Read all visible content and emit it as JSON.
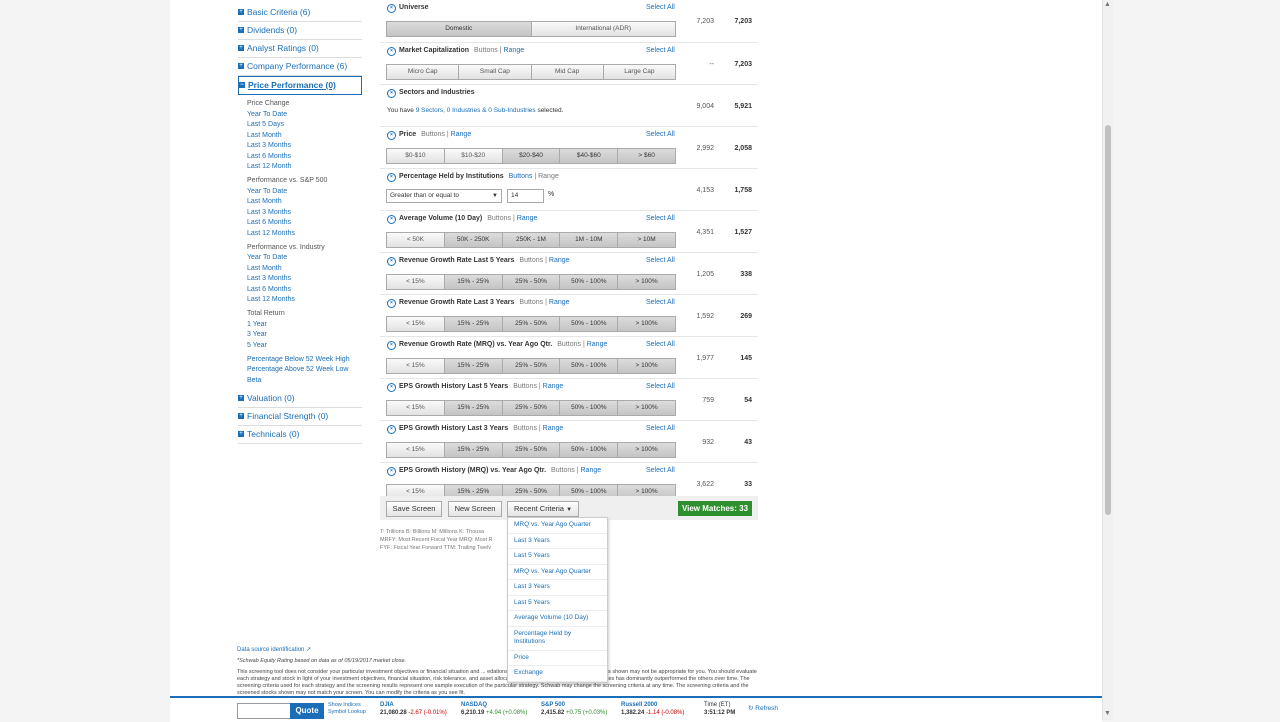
{
  "sidebar": {
    "categories_top": [
      {
        "label": "Basic Criteria (6)"
      },
      {
        "label": "Dividends (0)"
      },
      {
        "label": "Analyst Ratings (0)"
      },
      {
        "label": "Company Performance (6)"
      }
    ],
    "active_category": "Price Performance (0)",
    "subgroups": [
      {
        "heading": "Price Change",
        "links": [
          "Year To Date",
          "Last 5 Days",
          "Last Month",
          "Last 3 Months",
          "Last 6 Months",
          "Last 12 Month"
        ]
      },
      {
        "heading": "Performance vs. S&P 500",
        "links": [
          "Year To Date",
          "Last Month",
          "Last 3 Months",
          "Last 6 Months",
          "Last 12 Months"
        ]
      },
      {
        "heading": "Performance vs. Industry",
        "links": [
          "Year To Date",
          "Last Month",
          "Last 3 Months",
          "Last 6 Months",
          "Last 12 Months"
        ]
      },
      {
        "heading": "Total Return",
        "links": [
          "1 Year",
          "3 Year",
          "5 Year"
        ]
      },
      {
        "heading": "",
        "links": [
          "Percentage Below 52 Week High",
          "Percentage Above 52 Week Low",
          "Beta"
        ]
      }
    ],
    "categories_bottom": [
      {
        "label": "Valuation (0)"
      },
      {
        "label": "Financial Strength (0)"
      },
      {
        "label": "Technicals (0)"
      }
    ]
  },
  "criteria": [
    {
      "title": "Universe",
      "modes": "",
      "select_all": "Select All",
      "count1": "7,203",
      "count2": "7,203",
      "kind": "buttons",
      "buttons": [
        {
          "label": "Domestic",
          "on": true
        },
        {
          "label": "International (ADR)",
          "on": false
        }
      ]
    },
    {
      "title": "Market Capitalization",
      "modes": "Buttons | Range",
      "select_all": "Select All",
      "count1": "--",
      "count2": "7,203",
      "kind": "buttons",
      "buttons": [
        {
          "label": "Micro Cap",
          "on": false
        },
        {
          "label": "Small Cap",
          "on": false
        },
        {
          "label": "Mid Cap",
          "on": false
        },
        {
          "label": "Large Cap",
          "on": false
        }
      ]
    },
    {
      "title": "Sectors and Industries",
      "modes": "",
      "select_all": "",
      "count1": "9,004",
      "count2": "5,921",
      "kind": "text",
      "text_pre": "You have ",
      "text_link": "9 Sectors, 0 Industries & 0 Sub-Industries",
      "text_post": " selected."
    },
    {
      "title": "Price",
      "modes": "Buttons | Range",
      "select_all": "Select All",
      "count1": "2,992",
      "count2": "2,058",
      "kind": "buttons",
      "buttons": [
        {
          "label": "$0-$10",
          "on": false
        },
        {
          "label": "$10-$20",
          "on": false
        },
        {
          "label": "$20-$40",
          "on": true
        },
        {
          "label": "$40-$60",
          "on": true
        },
        {
          "label": "> $60",
          "on": true
        }
      ]
    },
    {
      "title": "Percentage Held by Institutions",
      "modes": "Buttons | Range",
      "select_all": "",
      "count1": "4,153",
      "count2": "1,758",
      "kind": "select",
      "select_value": "Greater than or equal to",
      "input_value": "14",
      "unit": "%"
    },
    {
      "title": "Average Volume (10 Day)",
      "modes": "Buttons | Range",
      "select_all": "Select All",
      "count1": "4,351",
      "count2": "1,527",
      "kind": "buttons",
      "buttons": [
        {
          "label": "< 50K",
          "on": false
        },
        {
          "label": "50K - 250K",
          "on": true
        },
        {
          "label": "250K - 1M",
          "on": true
        },
        {
          "label": "1M - 10M",
          "on": true
        },
        {
          "label": "> 10M",
          "on": true
        }
      ]
    },
    {
      "title": "Revenue Growth Rate Last 5 Years",
      "modes": "Buttons | Range",
      "select_all": "Select All",
      "count1": "1,205",
      "count2": "338",
      "kind": "buttons",
      "buttons": [
        {
          "label": "< 15%",
          "on": false
        },
        {
          "label": "15% - 25%",
          "on": true
        },
        {
          "label": "25% - 50%",
          "on": true
        },
        {
          "label": "50% - 100%",
          "on": true
        },
        {
          "label": "> 100%",
          "on": true
        }
      ]
    },
    {
      "title": "Revenue Growth Rate Last 3 Years",
      "modes": "Buttons | Range",
      "select_all": "Select All",
      "count1": "1,592",
      "count2": "269",
      "kind": "buttons",
      "buttons": [
        {
          "label": "< 15%",
          "on": false
        },
        {
          "label": "15% - 25%",
          "on": true
        },
        {
          "label": "25% - 50%",
          "on": true
        },
        {
          "label": "50% - 100%",
          "on": true
        },
        {
          "label": "> 100%",
          "on": true
        }
      ]
    },
    {
      "title": "Revenue Growth Rate (MRQ) vs. Year Ago Qtr.",
      "modes": "Buttons | Range",
      "select_all": "Select All",
      "count1": "1,977",
      "count2": "145",
      "kind": "buttons",
      "buttons": [
        {
          "label": "< 15%",
          "on": false
        },
        {
          "label": "15% - 25%",
          "on": true
        },
        {
          "label": "25% - 50%",
          "on": true
        },
        {
          "label": "50% - 100%",
          "on": true
        },
        {
          "label": "> 100%",
          "on": true
        }
      ]
    },
    {
      "title": "EPS Growth History Last 5 Years",
      "modes": "Buttons | Range",
      "select_all": "Select All",
      "count1": "759",
      "count2": "54",
      "kind": "buttons",
      "buttons": [
        {
          "label": "< 15%",
          "on": false
        },
        {
          "label": "15% - 25%",
          "on": true
        },
        {
          "label": "25% - 50%",
          "on": true
        },
        {
          "label": "50% - 100%",
          "on": true
        },
        {
          "label": "> 100%",
          "on": true
        }
      ]
    },
    {
      "title": "EPS Growth History Last 3 Years",
      "modes": "Buttons | Range",
      "select_all": "Select All",
      "count1": "932",
      "count2": "43",
      "kind": "buttons",
      "buttons": [
        {
          "label": "< 15%",
          "on": false
        },
        {
          "label": "15% - 25%",
          "on": true
        },
        {
          "label": "25% - 50%",
          "on": true
        },
        {
          "label": "50% - 100%",
          "on": true
        },
        {
          "label": "> 100%",
          "on": true
        }
      ]
    },
    {
      "title": "EPS Growth History (MRQ) vs. Year Ago Qtr.",
      "modes": "Buttons | Range",
      "select_all": "Select All",
      "count1": "3,622",
      "count2": "33",
      "kind": "buttons",
      "buttons": [
        {
          "label": "< 15%",
          "on": false
        },
        {
          "label": "15% - 25%",
          "on": true
        },
        {
          "label": "25% - 50%",
          "on": true
        },
        {
          "label": "50% - 100%",
          "on": true
        },
        {
          "label": "> 100%",
          "on": true
        }
      ]
    }
  ],
  "actions": {
    "save": "Save Screen",
    "new": "New Screen",
    "recent": "Recent Criteria",
    "view_matches": "View Matches: 33"
  },
  "legend": [
    "T: Trillions   B: Billions   M: Millions   K: Thousa",
    "MRFY: Most Recent Fiscal Year   MRQ: Most R",
    "FYF: Fiscal Year Forward   TTM: Trailing Twelv"
  ],
  "recent_dropdown": [
    "MRQ vs. Year Ago Quarter",
    "Last 3 Years",
    "Last 5 Years",
    "MRQ vs. Year Ago Quarter",
    "Last 3 Years",
    "Last 5 Years",
    "Average Volume (10 Day)",
    "Percentage Held by Institutions",
    "Price",
    "Exchange"
  ],
  "footer": {
    "data_source": "Data source identification",
    "equity_rating": "*Schwab Equity Rating based on data as of 05/19/2017 market close.",
    "disclaimer": "This screening tool does not consider your particular investment objectives or financial situation and ... edations. The investment strategies and the stocks shown may not be appropriate for you. You should evaluate each strategy and stock in light of your investment objectives, financial situation, risk tolerance, and asset allocation plan. In the past, none of the strategies has dominantly outperformed the others over time. The screening criteria used for each strategy and the screening results represent one sample execution of the particular strategy. Schwab may change the screening criteria at any time. The screening criteria and the screened stocks shown may not match your screen. You can modify the criteria as you see fit."
  },
  "ticker": {
    "quote_button": "Quote",
    "show_indices": "Show Indices",
    "symbol_lookup": "Symbol Lookup",
    "indices": [
      {
        "name": "DJIA",
        "value": "21,080.28",
        "change": "-2.67 (-0.01%)",
        "dir": "neg"
      },
      {
        "name": "NASDAQ",
        "value": "6,210.19",
        "change": "+4.94 (+0.08%)",
        "dir": "pos"
      },
      {
        "name": "S&P 500",
        "value": "2,415.82",
        "change": "+0.75 (+0.03%)",
        "dir": "pos"
      },
      {
        "name": "Russell 2000",
        "value": "1,382.24",
        "change": "-1.14 (-0.08%)",
        "dir": "neg"
      }
    ],
    "time_label": "Time (ET)",
    "time_value": "3:51:12 PM",
    "refresh": "Refresh"
  },
  "colors": {
    "link": "#1a6eb8",
    "accent_green": "#2d8f2d",
    "negative": "#cc0000"
  }
}
